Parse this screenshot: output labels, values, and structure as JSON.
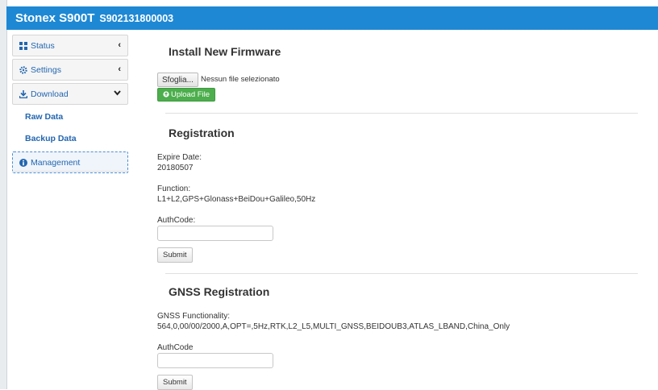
{
  "header": {
    "brand": "Stonex S900T",
    "serial": "S902131800003"
  },
  "sidebar": {
    "items": [
      {
        "label": "Status",
        "icon": "grid-icon"
      },
      {
        "label": "Settings",
        "icon": "gear-icon"
      },
      {
        "label": "Download",
        "icon": "download-icon"
      }
    ],
    "download_sub": [
      "Raw Data",
      "Backup Data"
    ],
    "management": {
      "label": "Management",
      "icon": "info-icon"
    }
  },
  "firmware": {
    "title": "Install New Firmware",
    "browse_label": "Sfoglia...",
    "file_status": "Nessun file selezionato",
    "upload_label": "Upload File",
    "upload_color": "#4cae4c"
  },
  "registration": {
    "title": "Registration",
    "expire_label": "Expire Date:",
    "expire_value": "20180507",
    "function_label": "Function:",
    "function_value": "L1+L2,GPS+Glonass+BeiDou+Galileo,50Hz",
    "authcode_label": "AuthCode:",
    "submit_label": "Submit"
  },
  "gnss_registration": {
    "title": "GNSS Registration",
    "functionality_label": "GNSS Functionality:",
    "functionality_value": "564,0,00/00/2000,A,OPT=,5Hz,RTK,L2_L5,MULTI_GNSS,BEIDOUB3,ATLAS_LBAND,China_Only",
    "authcode_label": "AuthCode",
    "submit_label": "Submit"
  },
  "colors": {
    "header": "#1e88d4",
    "link": "#2266b0"
  }
}
